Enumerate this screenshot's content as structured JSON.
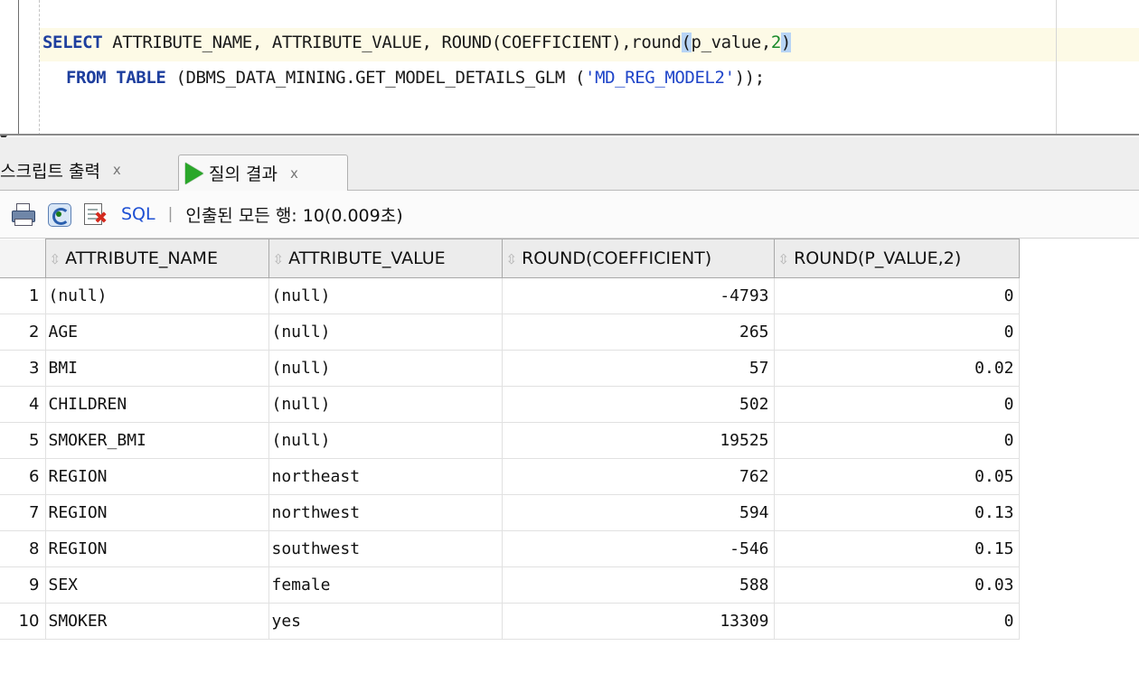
{
  "editor": {
    "line1": {
      "select": "SELECT",
      "cols": " ATTRIBUTE_NAME, ATTRIBUTE_VALUE, ROUND(COEFFICIENT),round",
      "open_paren": "(",
      "arg": "p_value,",
      "digits": "2",
      "close_paren": ")"
    },
    "line2": {
      "from": "FROM",
      "table": "TABLE",
      "call": " (DBMS_DATA_MINING.GET_MODEL_DETAILS_GLM (",
      "literal": "'MD_REG_MODEL2'",
      "end": "));"
    }
  },
  "tabs": [
    {
      "label": "스크립트 출력",
      "close": "x"
    },
    {
      "label": "질의 결과",
      "close": "x"
    }
  ],
  "toolbar": {
    "sql_label": "SQL",
    "separator": "|",
    "row_info": "인출된 모든 행: 10(0.009초)"
  },
  "grid": {
    "columns": [
      "ATTRIBUTE_NAME",
      "ATTRIBUTE_VALUE",
      "ROUND(COEFFICIENT)",
      "ROUND(P_VALUE,2)"
    ],
    "rows": [
      [
        "1",
        "(null)",
        "(null)",
        "-4793",
        "0"
      ],
      [
        "2",
        "AGE",
        "(null)",
        "265",
        "0"
      ],
      [
        "3",
        "BMI",
        "(null)",
        "57",
        "0.02"
      ],
      [
        "4",
        "CHILDREN",
        "(null)",
        "502",
        "0"
      ],
      [
        "5",
        "SMOKER_BMI",
        "(null)",
        "19525",
        "0"
      ],
      [
        "6",
        "REGION",
        "northeast",
        "762",
        "0.05"
      ],
      [
        "7",
        "REGION",
        "northwest",
        "594",
        "0.13"
      ],
      [
        "8",
        "REGION",
        "southwest",
        "-546",
        "0.15"
      ],
      [
        "9",
        "SEX",
        "female",
        "588",
        "0.03"
      ],
      [
        "10",
        "SMOKER",
        "yes",
        "13309",
        "0"
      ]
    ]
  },
  "colors": {
    "keyword": "#1e3f9e",
    "string_literal": "#1f45c9",
    "number_literal": "#1a8a2a",
    "run_icon": "#2aa72a",
    "sql_link": "#1d4fd3"
  }
}
